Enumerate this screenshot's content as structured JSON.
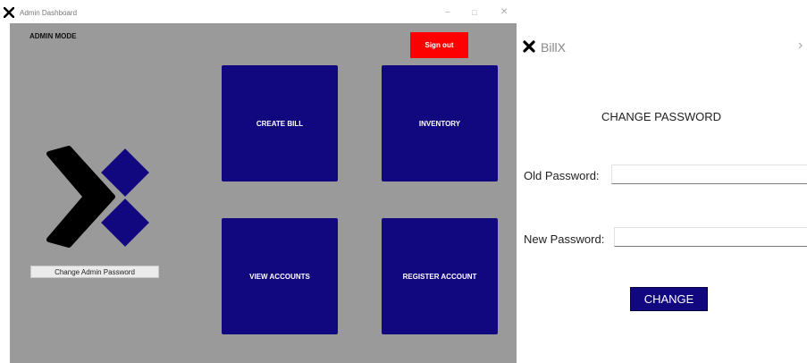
{
  "admin_window": {
    "title": "Admin Dashboard",
    "controls": {
      "minimize": "–",
      "maximize": "□",
      "close": "✕"
    },
    "mode_label": "ADMIN MODE",
    "sign_out_label": "Sign out",
    "tiles": {
      "create_bill": "CREATE BILL",
      "inventory": "INVENTORY",
      "view_accounts": "VIEW ACCOUNTS",
      "register_account": "REGISTER ACCOUNT"
    },
    "change_admin_password_label": "Change Admin Password",
    "icons": {
      "titlebar": "x-logo-icon",
      "logo": "billx-logo"
    }
  },
  "password_dialog": {
    "app_name": "BillX",
    "chevron": "›",
    "heading": "CHANGE PASSWORD",
    "old_password_label": "Old Password:",
    "new_password_label": "New Password:",
    "old_password_value": "",
    "new_password_value": "",
    "change_label": "CHANGE"
  },
  "colors": {
    "panel_bg": "#9a9a9a",
    "tile_bg": "#11077f",
    "sign_out_bg": "#fe0000",
    "logo_black": "#000000",
    "logo_blue": "#11077f"
  }
}
